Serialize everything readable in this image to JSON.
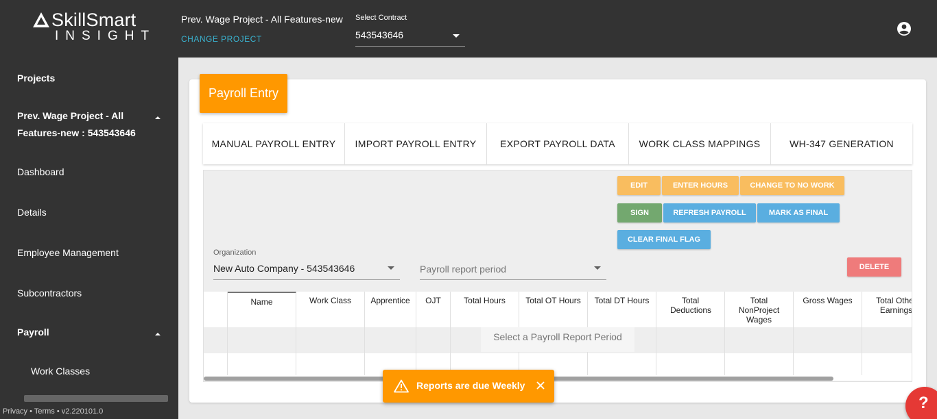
{
  "header": {
    "logo_name": "SkillSmart",
    "logo_sub": "INSIGHT",
    "project_title": "Prev. Wage Project - All Features-new",
    "change_project": "CHANGE PROJECT",
    "contract_label": "Select Contract",
    "contract_value": "543543646",
    "account_icon": "account-circle-icon"
  },
  "sidebar": {
    "projects": "Projects",
    "current_project_line1": "Prev. Wage Project - All",
    "current_project_line2": "Features-new : 543543646",
    "dashboard": "Dashboard",
    "details": "Details",
    "employee_management": "Employee Management",
    "subcontractors": "Subcontractors",
    "payroll": "Payroll",
    "work_classes": "Work Classes",
    "footer": "Privacy • Terms • v2.220101.0"
  },
  "page": {
    "card_title": "Payroll Entry",
    "tabs": [
      "MANUAL PAYROLL ENTRY",
      "IMPORT PAYROLL ENTRY",
      "EXPORT PAYROLL DATA",
      "WORK CLASS MAPPINGS",
      "WH-347 GENERATION"
    ],
    "buttons": {
      "edit": "EDIT",
      "enter_hours": "ENTER HOURS",
      "change_no_work": "CHANGE TO NO WORK",
      "sign": "SIGN",
      "refresh_payroll": "REFRESH PAYROLL",
      "mark_final": "MARK AS FINAL",
      "clear_final": "CLEAR FINAL FLAG",
      "delete": "DELETE"
    },
    "organization_label": "Organization",
    "organization_value": "New Auto Company - 543543646",
    "period_placeholder": "Payroll report period",
    "table": {
      "columns": [
        "",
        "Name",
        "Work Class",
        "Apprentice",
        "OJT",
        "Total Hours",
        "Total OT Hours",
        "Total DT Hours",
        "Total Deductions",
        "Total NonProject Wages",
        "Gross Wages",
        "Total Other Earnings"
      ],
      "empty_message": "Select a Payroll Report Period"
    }
  },
  "toast": {
    "message": "Reports are due Weekly",
    "icon": "warning-icon",
    "close_icon": "close-icon"
  },
  "help": {
    "label": "?"
  },
  "colors": {
    "topbar": "#333333",
    "accent_orange": "#ff9800",
    "link_teal": "#3ab3d0",
    "btn_green": "#73a86f",
    "btn_blue": "#5aaee0",
    "btn_red": "#ef7b7b"
  }
}
